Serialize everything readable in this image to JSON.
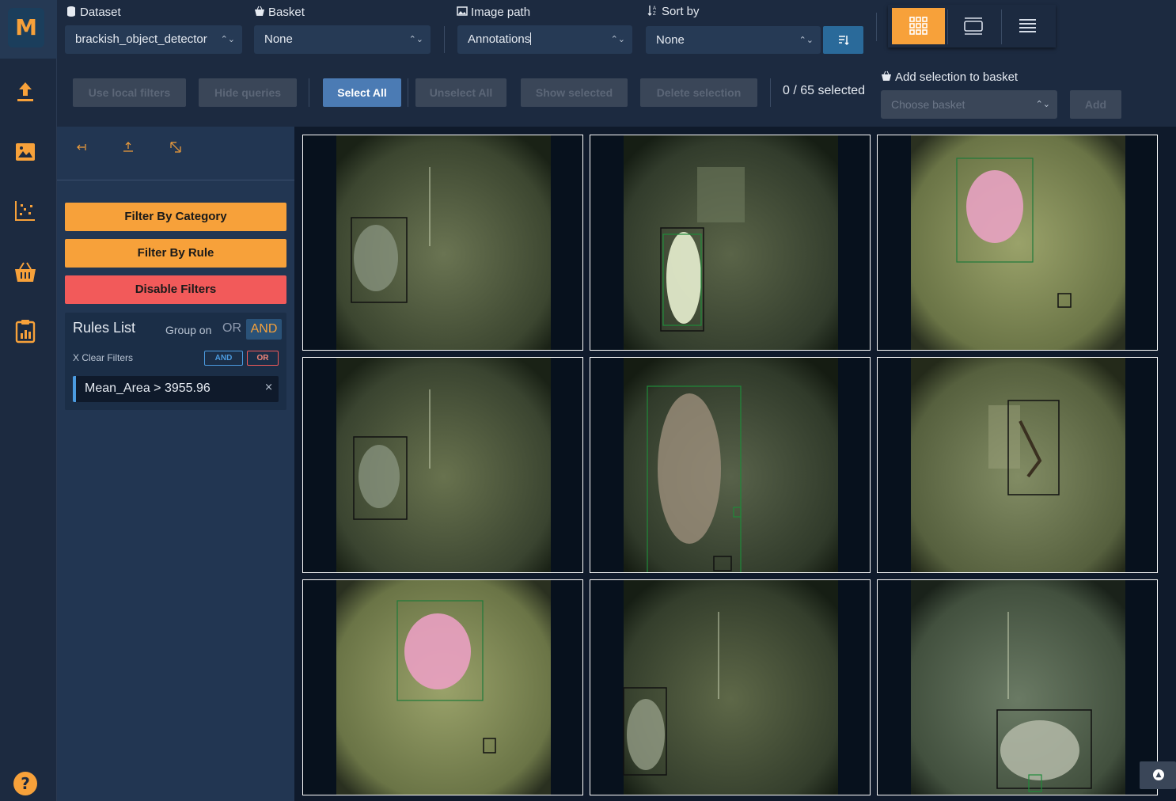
{
  "app": {
    "logo_letter": "M"
  },
  "rail": {
    "items": [
      {
        "name": "upload-icon"
      },
      {
        "name": "image-icon"
      },
      {
        "name": "scatter-icon"
      },
      {
        "name": "basket-icon"
      },
      {
        "name": "report-icon"
      }
    ],
    "help": "?"
  },
  "toolbar": {
    "dataset": {
      "label": "Dataset",
      "value": "brackish_object_detector"
    },
    "basket": {
      "label": "Basket",
      "value": "None"
    },
    "image_path": {
      "label": "Image path",
      "value": "Annotations"
    },
    "sort_by": {
      "label": "Sort by",
      "value": "None"
    },
    "buttons": {
      "use_local_filters": "Use local filters",
      "hide_queries": "Hide queries",
      "select_all": "Select All",
      "unselect_all": "Unselect All",
      "show_selected": "Show selected",
      "delete_selection": "Delete selection",
      "add": "Add"
    },
    "selection_count": "0 / 65 selected",
    "add_to_basket": {
      "label": "Add selection to basket",
      "placeholder": "Choose basket"
    },
    "accent_color": "#f7a13a"
  },
  "filters": {
    "filter_by_category": "Filter By Category",
    "filter_by_rule": "Filter By Rule",
    "disable_filters": "Disable Filters",
    "rules_list": {
      "title": "Rules List",
      "group_on": "Group on",
      "or": "OR",
      "and": "AND",
      "clear_filters": "X Clear Filters",
      "tag_and": "AND",
      "tag_or": "OR",
      "rules": [
        {
          "text": "Mean_Area > 3955.96",
          "remove": "×"
        }
      ]
    }
  },
  "grid": {
    "images": [
      {
        "name": "crab-cloudy",
        "tint": "#4c5a3c",
        "annotations": 1
      },
      {
        "name": "fish-with-sign",
        "tint": "#3e4a38",
        "annotations": 2
      },
      {
        "name": "pink-jellyfish",
        "tint": "#7a8450",
        "annotations": 2
      },
      {
        "name": "crab-cloudy-2",
        "tint": "#4a5838",
        "annotations": 1
      },
      {
        "name": "big-fish",
        "tint": "#3a4430",
        "annotations": 3
      },
      {
        "name": "shrimp-sign",
        "tint": "#5e6a48",
        "annotations": 1
      },
      {
        "name": "pink-jellyfish-2",
        "tint": "#7a8450",
        "annotations": 2
      },
      {
        "name": "crab-left",
        "tint": "#3e4a34",
        "annotations": 1
      },
      {
        "name": "fish-bottom-right",
        "tint": "#4a5a4a",
        "annotations": 2
      }
    ]
  }
}
